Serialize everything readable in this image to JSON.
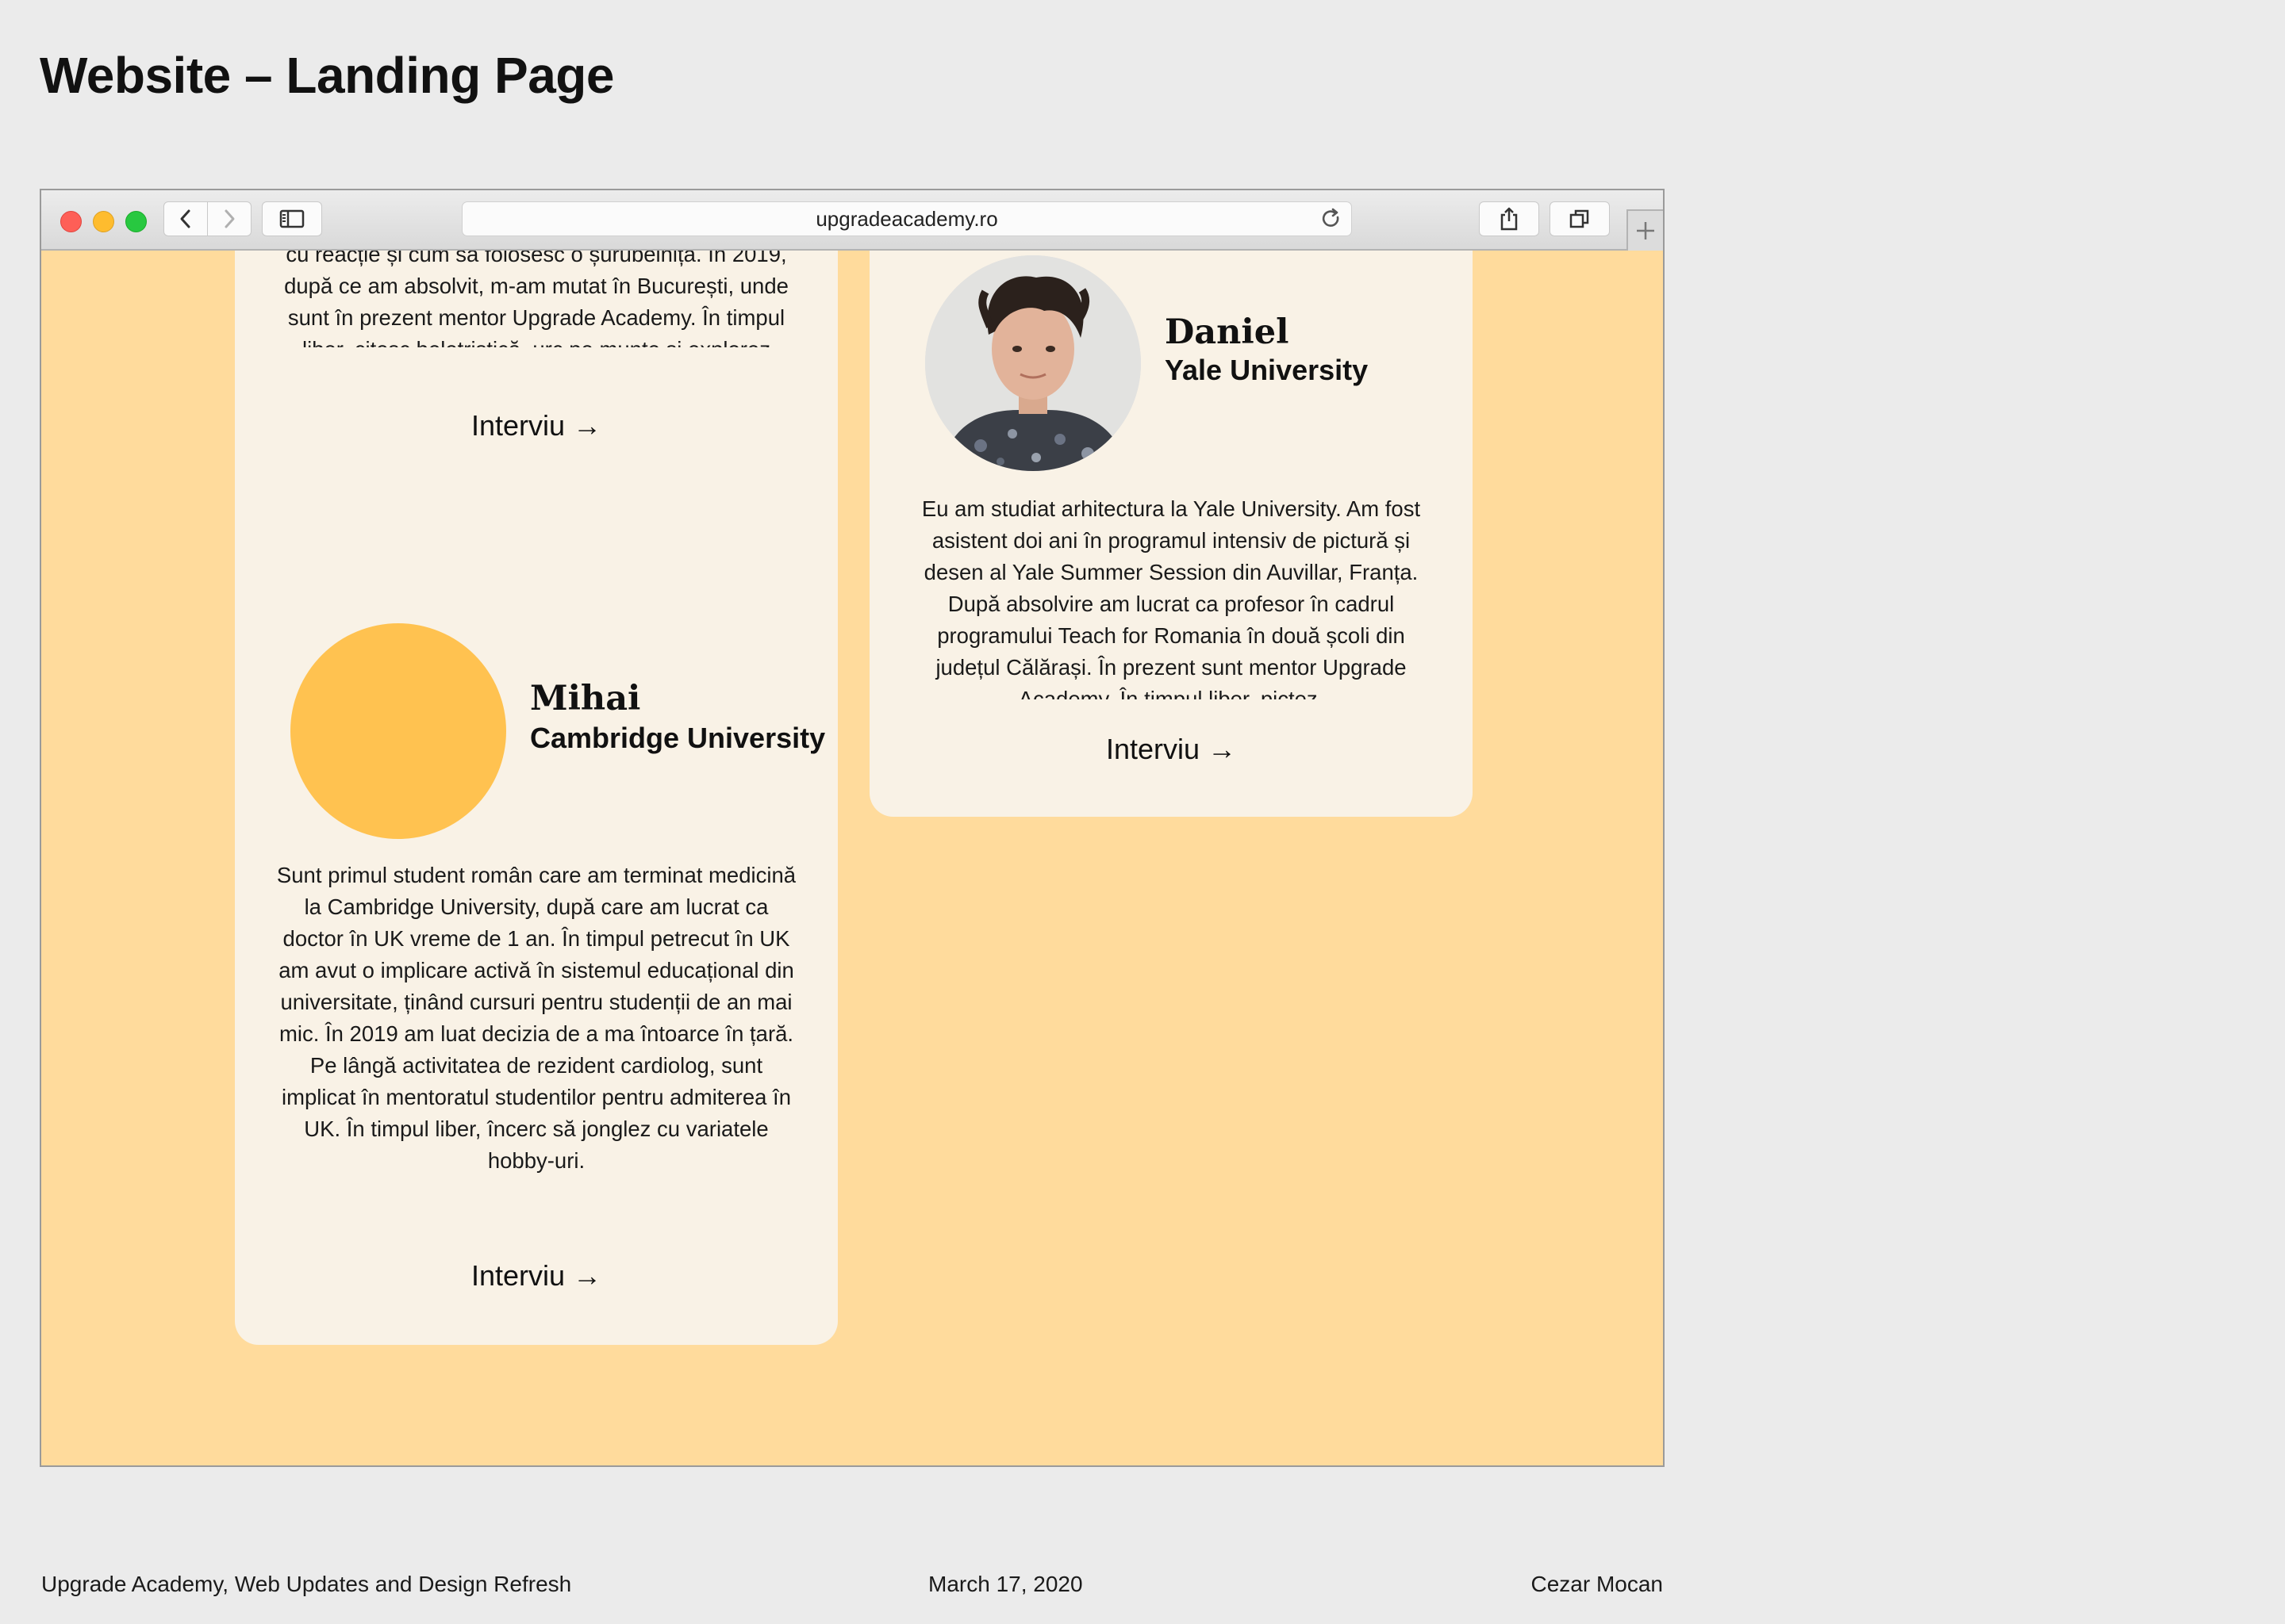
{
  "page": {
    "title": "Website – Landing Page"
  },
  "browser": {
    "url": "upgradeacademy.ro"
  },
  "cards": {
    "top_left": {
      "text": "Sunt inginer electric. Am studiat la Politehnica producerea energiei electrice, motoarele avioanelor cu reacție și cum să folosesc o șurubelniță. În 2019, după ce am absolvit, m-am mutat în București, unde sunt în prezent mentor Upgrade Academy. În timpul liber, citesc beletristică, urc pe munte și explorez orașul.",
      "link": "Interviu →"
    },
    "mihai": {
      "name": "Mihai",
      "university": "Cambridge University",
      "avatar_color": "#ffc250",
      "text": "Sunt primul student român care am terminat medicină la Cambridge University, după care am lucrat ca doctor în UK vreme de 1 an. În timpul petrecut în UK am avut o implicare activă în sistemul educațional din universitate, ținând cursuri pentru studenții de an mai mic. În 2019 am luat decizia de a ma întoarce în țară. Pe lângă activitatea de rezident cardiolog, sunt implicat în mentoratul studentilor pentru admiterea în UK. În timpul liber, încerc să jonglez cu variatele hobby-uri.",
      "link": "Interviu →"
    },
    "daniel": {
      "name": "Daniel",
      "university": "Yale University",
      "text": "Eu am studiat arhitectura la Yale University. Am fost asistent doi ani în programul intensiv de pictură și desen al Yale Summer Session din Auvillar, Franța. După absolvire am lucrat ca profesor în cadrul programului Teach for Romania în două școli din județul Călărași. În prezent sunt mentor Upgrade Academy. În timpul liber, pictez.",
      "link": "Interviu →"
    }
  },
  "footer": {
    "project": "Upgrade Academy, Web Updates and Design Refresh",
    "date": "March 17, 2020",
    "author": "Cezar Mocan"
  },
  "colors": {
    "page_background": "#ebebeb",
    "site_background": "#ffdb9c",
    "card_background": "#f9f2e6",
    "accent_yellow": "#ffc250"
  }
}
